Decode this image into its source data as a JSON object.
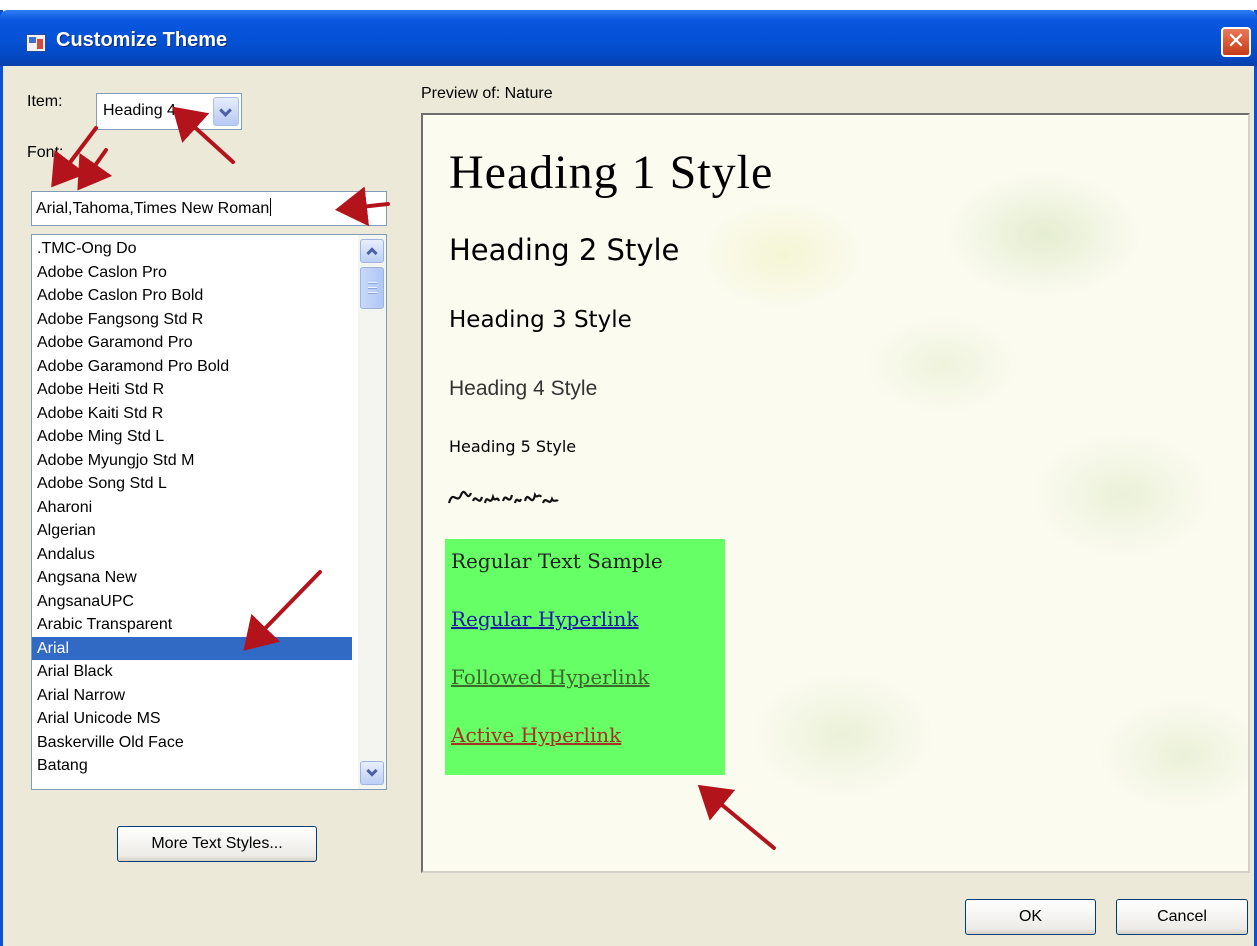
{
  "window": {
    "title": "Customize Theme",
    "close_glyph": "✕"
  },
  "item": {
    "label": "Item:",
    "selected": "Heading 4"
  },
  "font": {
    "label": "Font:",
    "input_value": "Arial,Tahoma,Times New Roman",
    "list": [
      ".TMC-Ong Do",
      "Adobe Caslon Pro",
      "Adobe Caslon Pro Bold",
      "Adobe Fangsong Std R",
      "Adobe Garamond Pro",
      "Adobe Garamond Pro Bold",
      "Adobe Heiti Std R",
      "Adobe Kaiti Std R",
      "Adobe Ming Std L",
      "Adobe Myungjo Std M",
      "Adobe Song Std L",
      "Aharoni",
      "Algerian",
      "Andalus",
      "Angsana New",
      "AngsanaUPC",
      "Arabic Transparent",
      "Arial",
      "Arial Black",
      "Arial Narrow",
      "Arial Unicode MS",
      "Baskerville Old Face",
      "Batang"
    ],
    "selected": "Arial"
  },
  "buttons": {
    "more_text_styles": "More Text Styles...",
    "ok": "OK",
    "cancel": "Cancel"
  },
  "preview": {
    "label": "Preview of: Nature",
    "heading1": "Heading 1 Style",
    "heading2": "Heading 2 Style",
    "heading3": "Heading 3 Style",
    "heading4": "Heading 4 Style",
    "heading5": "Heading 5 Style",
    "regular_text": "Regular Text Sample",
    "regular_link": "Regular Hyperlink",
    "followed_link": "Followed Hyperlink",
    "active_link": "Active Hyperlink"
  },
  "colors": {
    "titlebar": "#0552d8",
    "dialog_bg": "#ece9d8",
    "selection": "#316ac5",
    "sample_bg": "#66ff66",
    "annotation_arrow": "#b3141c"
  }
}
